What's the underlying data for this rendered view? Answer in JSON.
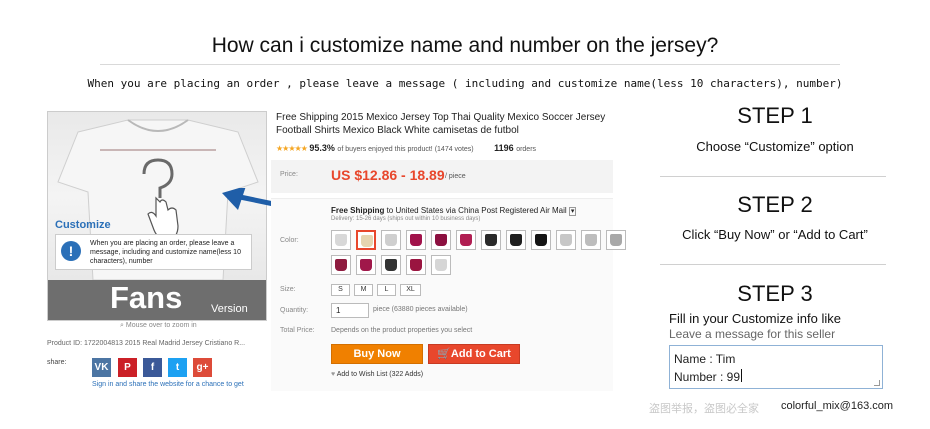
{
  "header": {
    "title": "How can i customize name and number on the jersey?",
    "subtitle": "When you are placing an order , please leave a message ( including and customize name(less 10 characters), number)"
  },
  "product_image": {
    "customize_label": "Customize",
    "customize_note": "When you are placing an order, please leave a message, including and customize name(less 10 characters), number",
    "fans_text": "Fans",
    "version_text": "Version",
    "zoom_hint": "Mouse over to zoom in",
    "product_id": "Product ID: 1722004813 2015 Real Madrid Jersey Cristiano R...",
    "share_label": "share:",
    "share_buttons": [
      "VK",
      "P",
      "f",
      "t",
      "g+"
    ],
    "signin_note": "Sign in and share the website for a chance to get"
  },
  "listing": {
    "title": "Free Shipping 2015 Mexico Jersey Top Thai Quality Mexico Soccer Jersey Football Shirts Mexico Black White camisetas de futbol",
    "rating_pct": "95.3%",
    "rating_text": "of buyers enjoyed this product! (1474 votes)",
    "orders": "1196",
    "orders_label": "orders",
    "price_label": "Price:",
    "price": "US $12.86 - 18.89",
    "price_unit": "/ piece",
    "shipping_bold": "Free Shipping",
    "shipping_rest": "to United States via China Post Registered Air Mail",
    "delivery": "Delivery: 15-26 days (ships out within 10 business days)",
    "color_label": "Color:",
    "colors": [
      "#d8d8d8",
      "#e6d5b0",
      "#cfcfcf",
      "#a1124a",
      "#8c1040",
      "#b01e52",
      "#2a2a2a",
      "#1f1f1f",
      "#141414",
      "#c7c7c7",
      "#bdbdbd",
      "#a8a8a8",
      "#8e1b3f",
      "#a0184a",
      "#333333",
      "#9a1540",
      "#d6d6d6"
    ],
    "size_label": "Size:",
    "sizes": [
      "S",
      "M",
      "L",
      "XL"
    ],
    "quantity_label": "Quantity:",
    "quantity": "1",
    "quantity_note": "piece (63880 pieces available)",
    "total_label": "Total Price:",
    "total_note": "Depends on the product properties you select",
    "buy_now": "Buy Now",
    "add_to_cart": "Add to Cart",
    "wish_list": "Add to Wish List (322 Adds)"
  },
  "steps": [
    {
      "title": "STEP 1",
      "desc": "Choose “Customize”  option"
    },
    {
      "title": "STEP 2",
      "desc": "Click “Buy Now” or “Add to Cart”"
    },
    {
      "title": "STEP 3",
      "fill_title": "Fill in your Customize info like",
      "fill_sub": "Leave a message for this seller",
      "message_lines": [
        "Name : Tim",
        "Number : 99"
      ]
    }
  ],
  "footer": {
    "watermark_cn": "盗图举报，盗图必全家",
    "email": "colorful_mix@163.com"
  },
  "colors": {
    "accent_red": "#e8472c",
    "buy_orange": "#f08000",
    "link_blue": "#2b70b8",
    "arrow_blue": "#1f5ea8"
  }
}
